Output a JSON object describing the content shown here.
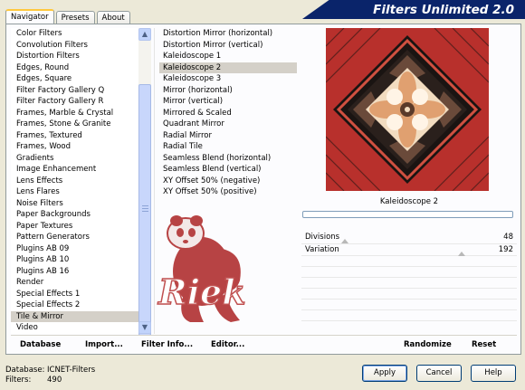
{
  "tabs": [
    "Navigator",
    "Presets",
    "About"
  ],
  "banner_title": "Filters Unlimited 2.0",
  "categories": [
    "Color Filters",
    "Convolution Filters",
    "Distortion Filters",
    "Edges, Round",
    "Edges, Square",
    "Filter Factory Gallery Q",
    "Filter Factory Gallery R",
    "Frames, Marble & Crystal",
    "Frames, Stone & Granite",
    "Frames, Textured",
    "Frames, Wood",
    "Gradients",
    "Image Enhancement",
    "Lens Effects",
    "Lens Flares",
    "Noise Filters",
    "Paper Backgrounds",
    "Paper Textures",
    "Pattern Generators",
    "Plugins AB 09",
    "Plugins AB 10",
    "Plugins AB 16",
    "Render",
    "Special Effects 1",
    "Special Effects 2",
    "Tile & Mirror",
    "Video"
  ],
  "selected_category": "Tile & Mirror",
  "filters": [
    "Distortion Mirror (horizontal)",
    "Distortion Mirror (vertical)",
    "Kaleidoscope 1",
    "Kaleidoscope 2",
    "Kaleidoscope 3",
    "Mirror (horizontal)",
    "Mirror (vertical)",
    "Mirrored & Scaled",
    "Quadrant Mirror",
    "Radial Mirror",
    "Radial Tile",
    "Seamless Blend (horizontal)",
    "Seamless Blend (vertical)",
    "XY Offset 50% (negative)",
    "XY Offset 50% (positive)"
  ],
  "selected_filter": "Kaleidoscope 2",
  "logo_text": "Riek",
  "preview": {
    "label": "Kaleidoscope 2",
    "colors": {
      "red": "#b8302c",
      "dark": "#1a1412",
      "cream": "#f2dcc0",
      "peach": "#e0a070"
    }
  },
  "parameters": [
    {
      "name": "Divisions",
      "value": "48",
      "level": 0.19
    },
    {
      "name": "Variation",
      "value": "192",
      "level": 0.75
    }
  ],
  "toolbar": {
    "database": "Database",
    "import": "Import...",
    "filter_info": "Filter Info...",
    "editor": "Editor...",
    "randomize": "Randomize",
    "reset": "Reset"
  },
  "footer": {
    "database_label": "Database:",
    "database_value": "ICNET-Filters",
    "filters_label": "Filters:",
    "filters_value": "490"
  },
  "buttons": {
    "apply": "Apply",
    "cancel": "Cancel",
    "help": "Help"
  }
}
